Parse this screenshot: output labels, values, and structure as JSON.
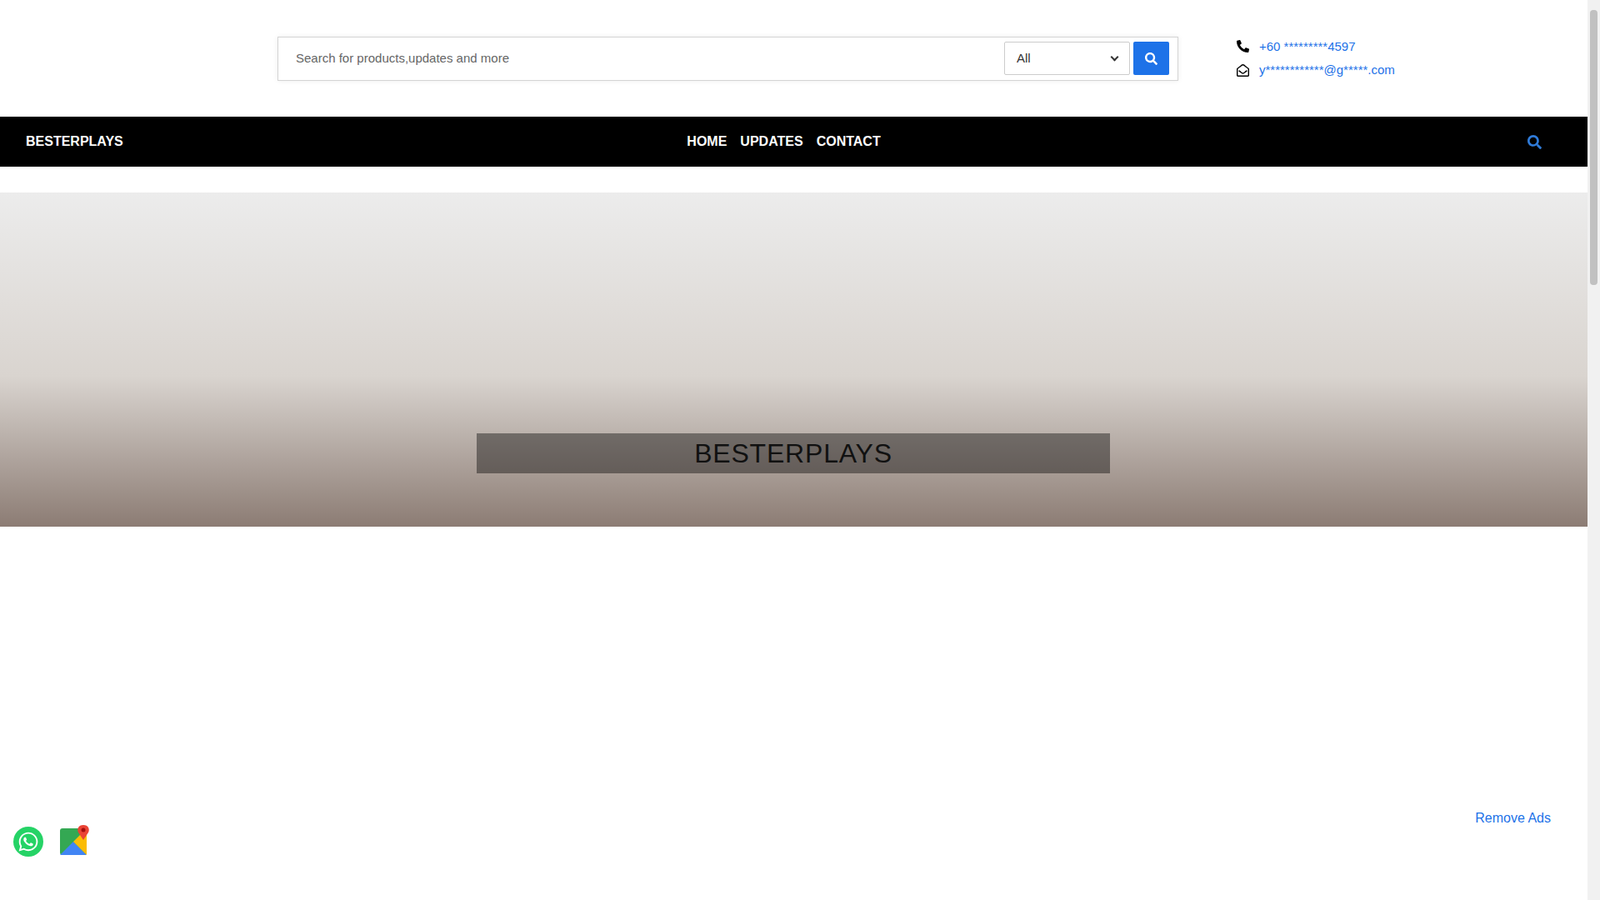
{
  "search": {
    "placeholder": "Search for products,updates and more",
    "category": "All"
  },
  "contact": {
    "phone": "+60 *********4597",
    "email": "y************@g*****.com"
  },
  "nav": {
    "brand": "BESTERPLAYS",
    "links": [
      "HOME",
      "UPDATES",
      "CONTACT"
    ]
  },
  "hero": {
    "title": "BESTERPLAYS"
  },
  "remove_ads": "Remove Ads"
}
